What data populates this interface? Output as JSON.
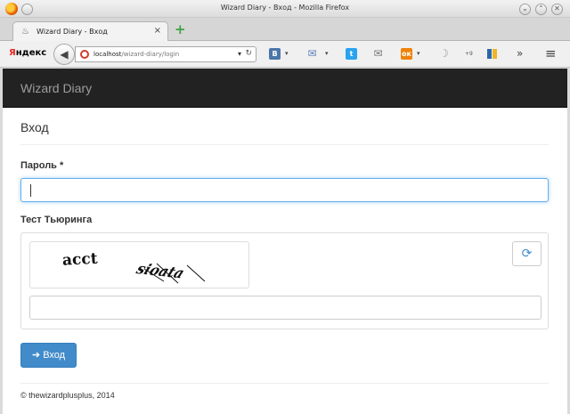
{
  "window": {
    "title": "Wizard Diary - Вход - Mozilla Firefox",
    "min_glyph": "⌄",
    "max_glyph": "⌃",
    "close_glyph": "✕"
  },
  "tab": {
    "title": "Wizard Diary - Вход",
    "close_glyph": "×",
    "new_tab_glyph": "+"
  },
  "toolbar": {
    "search_logo_first": "Я",
    "search_logo_rest": "ндекс",
    "url_host": "localhost",
    "url_path": "/wizard-diary/login",
    "vk_label": "В",
    "ok_label": "ок",
    "counter": "+9",
    "overflow_glyph": "»",
    "menu_glyph": "≡"
  },
  "app": {
    "brand": "Wizard Diary"
  },
  "form": {
    "heading": "Вход",
    "password_label": "Пароль *",
    "password_value": "",
    "captcha_label": "Тест Тьюринга",
    "captcha_text_1": "acct",
    "captcha_text_2": "sioata",
    "captcha_value": "",
    "submit_label": "Вход"
  },
  "footer": {
    "copyright": "© thewizardplusplus, 2014"
  },
  "colors": {
    "navbar_bg": "#222222",
    "brand_text": "#9d9d9d",
    "primary": "#428bca",
    "focus_border": "#66afe9"
  }
}
